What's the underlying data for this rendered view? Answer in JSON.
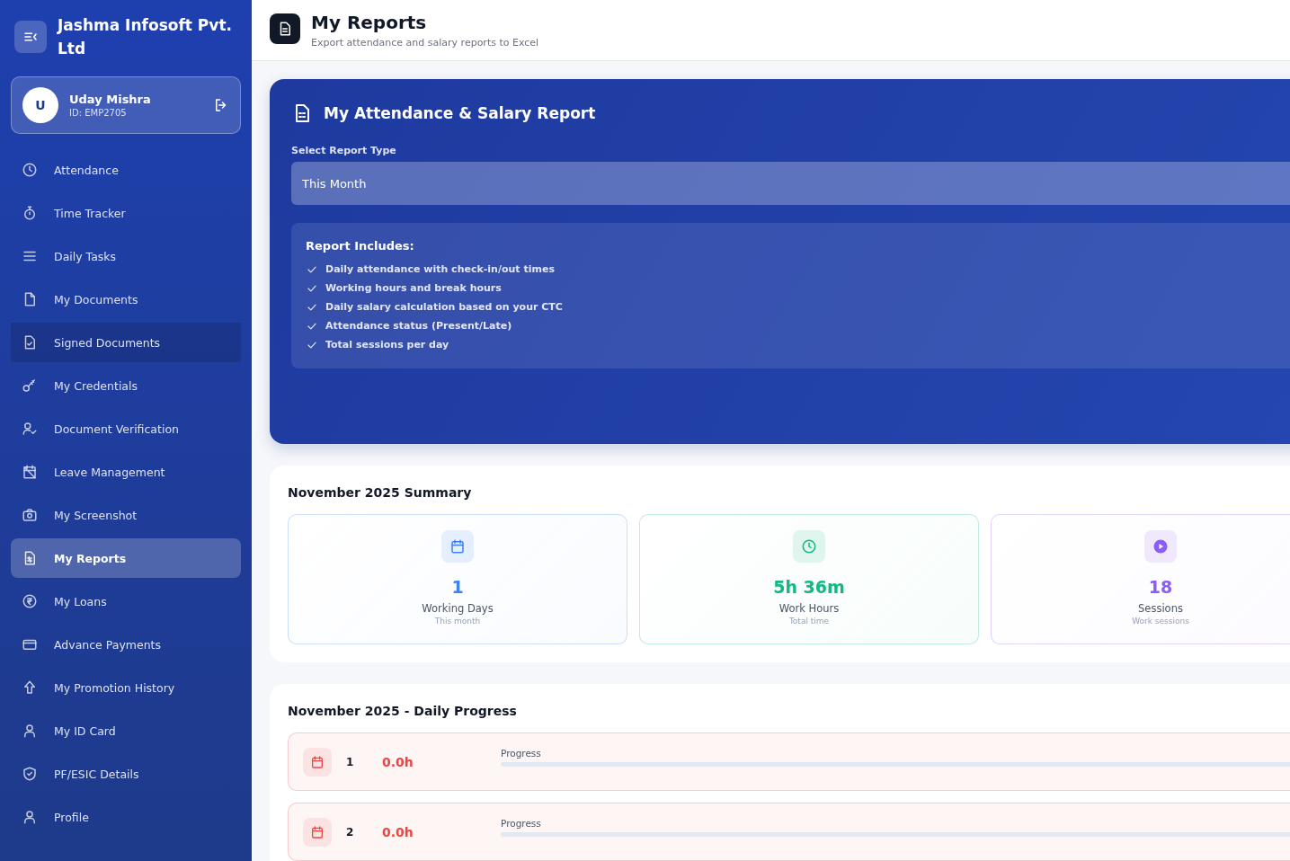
{
  "sidebar": {
    "company": "Jashma Infosoft Pvt. Ltd",
    "user": {
      "initial": "U",
      "name": "Uday Mishra",
      "id": "ID: EMP2705"
    },
    "items": [
      {
        "label": "Attendance",
        "selected": false,
        "highlighted": false
      },
      {
        "label": "Time Tracker",
        "selected": false,
        "highlighted": false
      },
      {
        "label": "Daily Tasks",
        "selected": false,
        "highlighted": false
      },
      {
        "label": "My Documents",
        "selected": false,
        "highlighted": false
      },
      {
        "label": "Signed Documents",
        "selected": false,
        "highlighted": true
      },
      {
        "label": "My Credentials",
        "selected": false,
        "highlighted": false
      },
      {
        "label": "Document Verification",
        "selected": false,
        "highlighted": false
      },
      {
        "label": "Leave Management",
        "selected": false,
        "highlighted": false
      },
      {
        "label": "My Screenshot",
        "selected": false,
        "highlighted": false
      },
      {
        "label": "My Reports",
        "selected": true,
        "highlighted": false
      },
      {
        "label": "My Loans",
        "selected": false,
        "highlighted": false
      },
      {
        "label": "Advance Payments",
        "selected": false,
        "highlighted": false
      },
      {
        "label": "My Promotion History",
        "selected": false,
        "highlighted": false
      },
      {
        "label": "My ID Card",
        "selected": false,
        "highlighted": false
      },
      {
        "label": "PF/ESIC Details",
        "selected": false,
        "highlighted": false
      },
      {
        "label": "Profile",
        "selected": false,
        "highlighted": false
      }
    ]
  },
  "header": {
    "title": "My Reports",
    "subtitle": "Export attendance and salary reports to Excel"
  },
  "report": {
    "title": "My Attendance & Salary Report",
    "select_label": "Select Report Type",
    "select_value": "This Month",
    "includes_title": "Report Includes:",
    "includes": [
      "Daily attendance with check-in/out times",
      "Working hours and break hours",
      "Daily salary calculation based on your CTC",
      "Attendance status (Present/Late)",
      "Total sessions per day"
    ]
  },
  "summary": {
    "title": "November 2025 Summary",
    "stats": [
      {
        "value": "1",
        "label": "Working Days",
        "sub": "This month",
        "color": "#3b82f6"
      },
      {
        "value": "5h 36m",
        "label": "Work Hours",
        "sub": "Total time",
        "color": "#10b981"
      },
      {
        "value": "18",
        "label": "Sessions",
        "sub": "Work sessions",
        "color": "#8b5cf6"
      }
    ]
  },
  "progress": {
    "title": "November 2025 - Daily Progress",
    "days": [
      {
        "day": "1",
        "hours": "0.0h",
        "label": "Progress",
        "level": 0,
        "color": "#ef4444"
      },
      {
        "day": "2",
        "hours": "0.0h",
        "label": "Progress",
        "level": 0,
        "color": "#ef4444"
      }
    ]
  }
}
